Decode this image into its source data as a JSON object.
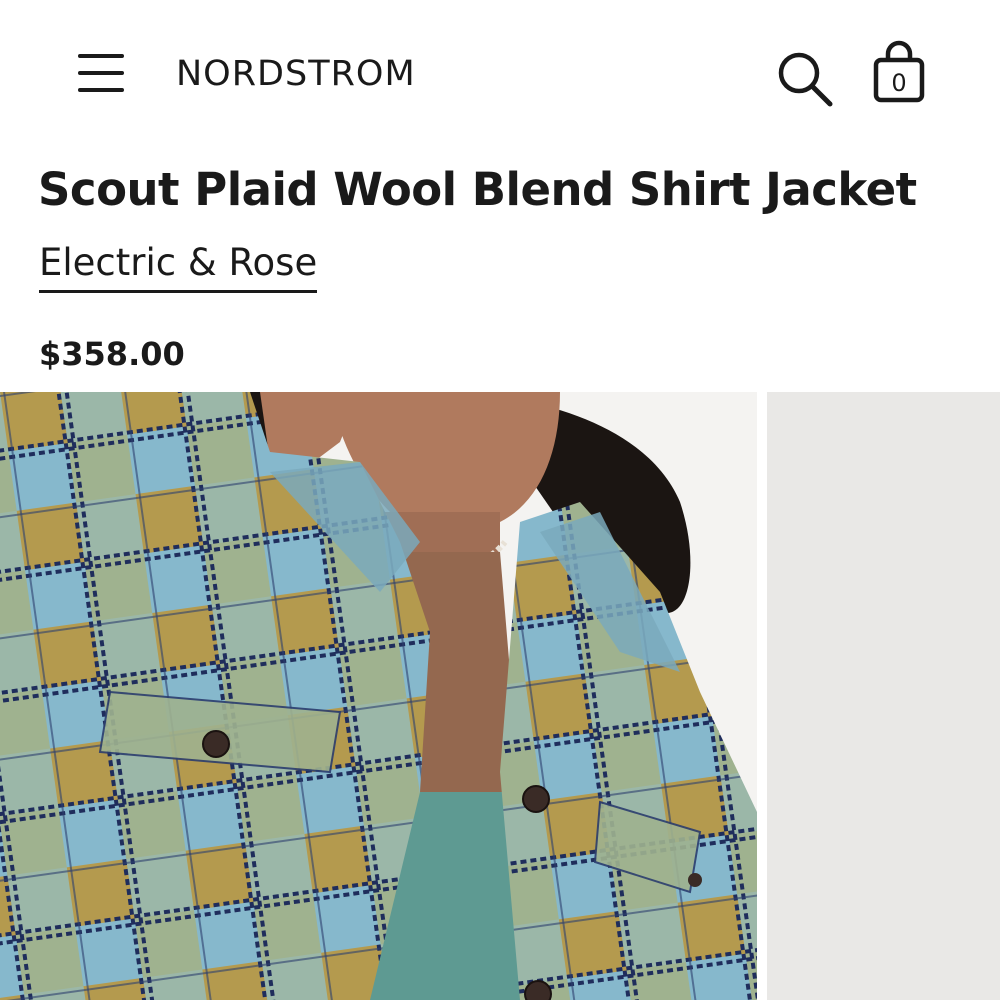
{
  "header": {
    "logo": "NORDSTROM",
    "menu_icon": "hamburger-menu-icon",
    "search_icon": "search-icon",
    "bag_icon": "shopping-bag-icon",
    "bag_count": "0"
  },
  "product": {
    "title": "Scout Plaid Wool Blend Shirt Jacket",
    "brand": "Electric & Rose",
    "price": "$358.00"
  },
  "colors": {
    "text": "#1a1a1a",
    "background": "#ffffff",
    "plaid_blue": "#86b8cc",
    "plaid_mustard": "#b49a4e",
    "plaid_navy": "#1f2d5c",
    "top_teal": "#5e9a92",
    "image_backdrop": "#e9e8e6"
  }
}
